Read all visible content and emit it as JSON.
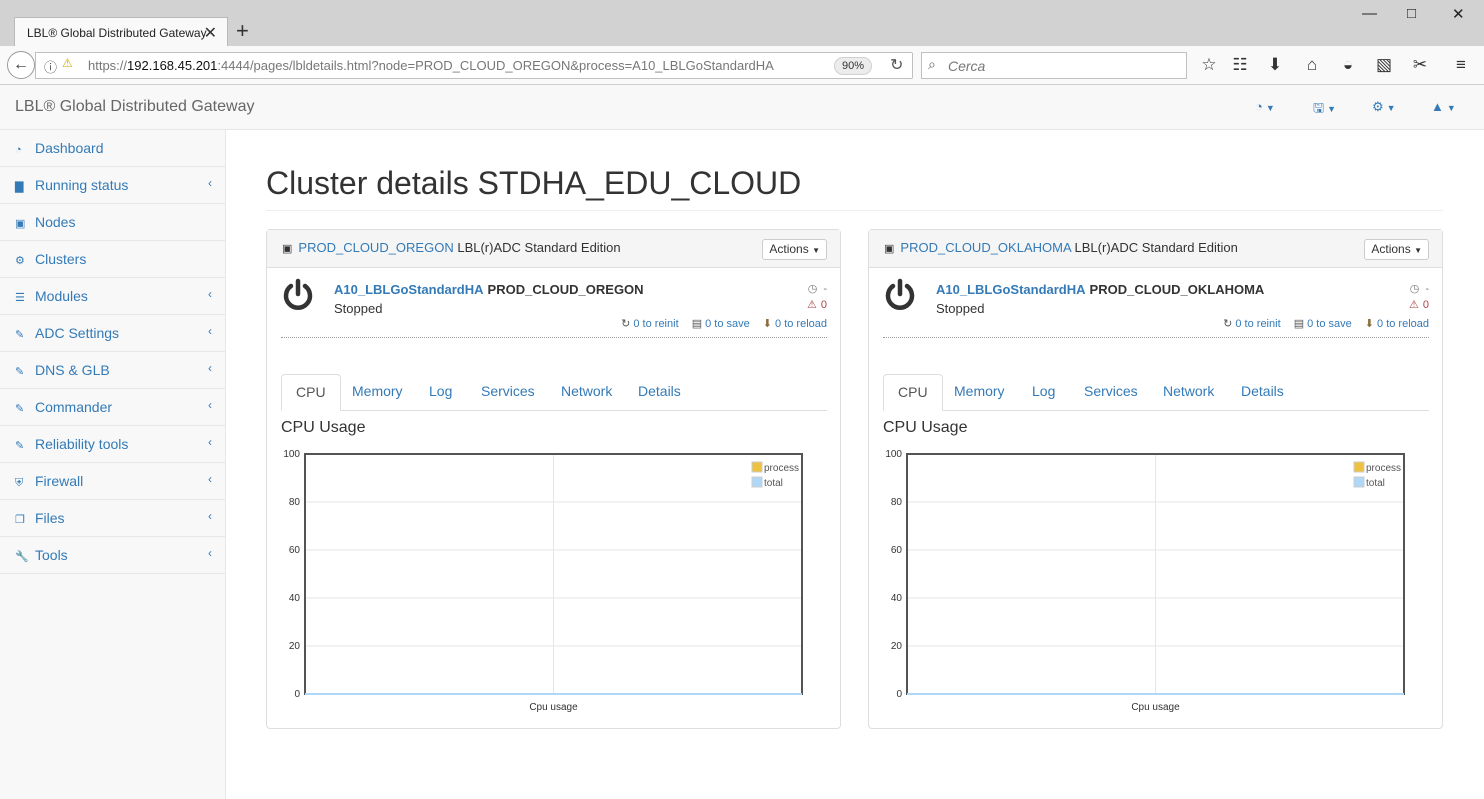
{
  "browser": {
    "tab_title": "LBL® Global Distributed Gateway",
    "url_prefix": "https://",
    "url_host": "192.168.45.201",
    "url_rest": ":4444/pages/lbldetails.html?node=PROD_CLOUD_OREGON&process=A10_LBLGoStandardHA",
    "zoom": "90%",
    "search_placeholder": "Cerca"
  },
  "app": {
    "brand": "LBL® Global Distributed Gateway"
  },
  "sidebar": {
    "items": [
      {
        "label": "Dashboard",
        "icon": "dashboard-icon"
      },
      {
        "label": "Running status",
        "icon": "bar-chart-icon"
      },
      {
        "label": "Nodes",
        "icon": "cube-icon"
      },
      {
        "label": "Clusters",
        "icon": "cogs-icon"
      },
      {
        "label": "Modules",
        "icon": "list-icon"
      },
      {
        "label": "ADC Settings",
        "icon": "edit-icon"
      },
      {
        "label": "DNS & GLB",
        "icon": "edit-icon"
      },
      {
        "label": "Commander",
        "icon": "edit-icon"
      },
      {
        "label": "Reliability tools",
        "icon": "edit-icon"
      },
      {
        "label": "Firewall",
        "icon": "shield-icon"
      },
      {
        "label": "Files",
        "icon": "files-icon"
      },
      {
        "label": "Tools",
        "icon": "wrench-icon"
      }
    ]
  },
  "page": {
    "title": "Cluster details STDHA_EDU_CLOUD"
  },
  "panels": [
    {
      "node": "PROD_CLOUD_OREGON",
      "edition": "LBL(r)ADC Standard Edition",
      "actions": "Actions",
      "process": "A10_LBLGoStandardHA",
      "process_node": "PROD_CLOUD_OREGON",
      "state": "Stopped",
      "uptime": "-",
      "alerts": "0",
      "reinit": "0 to reinit",
      "save": "0 to save",
      "reload": "0 to reload",
      "tabs": [
        "CPU",
        "Memory",
        "Log",
        "Services",
        "Network",
        "Details"
      ],
      "chart_heading": "CPU Usage"
    },
    {
      "node": "PROD_CLOUD_OKLAHOMA",
      "edition": "LBL(r)ADC Standard Edition",
      "actions": "Actions",
      "process": "A10_LBLGoStandardHA",
      "process_node": "PROD_CLOUD_OKLAHOMA",
      "state": "Stopped",
      "uptime": "-",
      "alerts": "0",
      "reinit": "0 to reinit",
      "save": "0 to save",
      "reload": "0 to reload",
      "tabs": [
        "CPU",
        "Memory",
        "Log",
        "Services",
        "Network",
        "Details"
      ],
      "chart_heading": "CPU Usage"
    }
  ],
  "chart_data": [
    {
      "type": "line",
      "title": "",
      "xlabel": "Cpu usage",
      "ylabel": "",
      "ylim": [
        0,
        100
      ],
      "yticks": [
        0,
        20,
        40,
        60,
        80,
        100
      ],
      "legend": "top-right",
      "grid": true,
      "series": [
        {
          "name": "process",
          "color": "#edc240",
          "values": [
            0,
            0
          ]
        },
        {
          "name": "total",
          "color": "#afd8f8",
          "values": [
            0,
            0
          ]
        }
      ]
    },
    {
      "type": "line",
      "title": "",
      "xlabel": "Cpu usage",
      "ylabel": "",
      "ylim": [
        0,
        100
      ],
      "yticks": [
        0,
        20,
        40,
        60,
        80,
        100
      ],
      "legend": "top-right",
      "grid": true,
      "series": [
        {
          "name": "process",
          "color": "#edc240",
          "values": [
            0,
            0
          ]
        },
        {
          "name": "total",
          "color": "#afd8f8",
          "values": [
            0,
            0
          ]
        }
      ]
    }
  ]
}
